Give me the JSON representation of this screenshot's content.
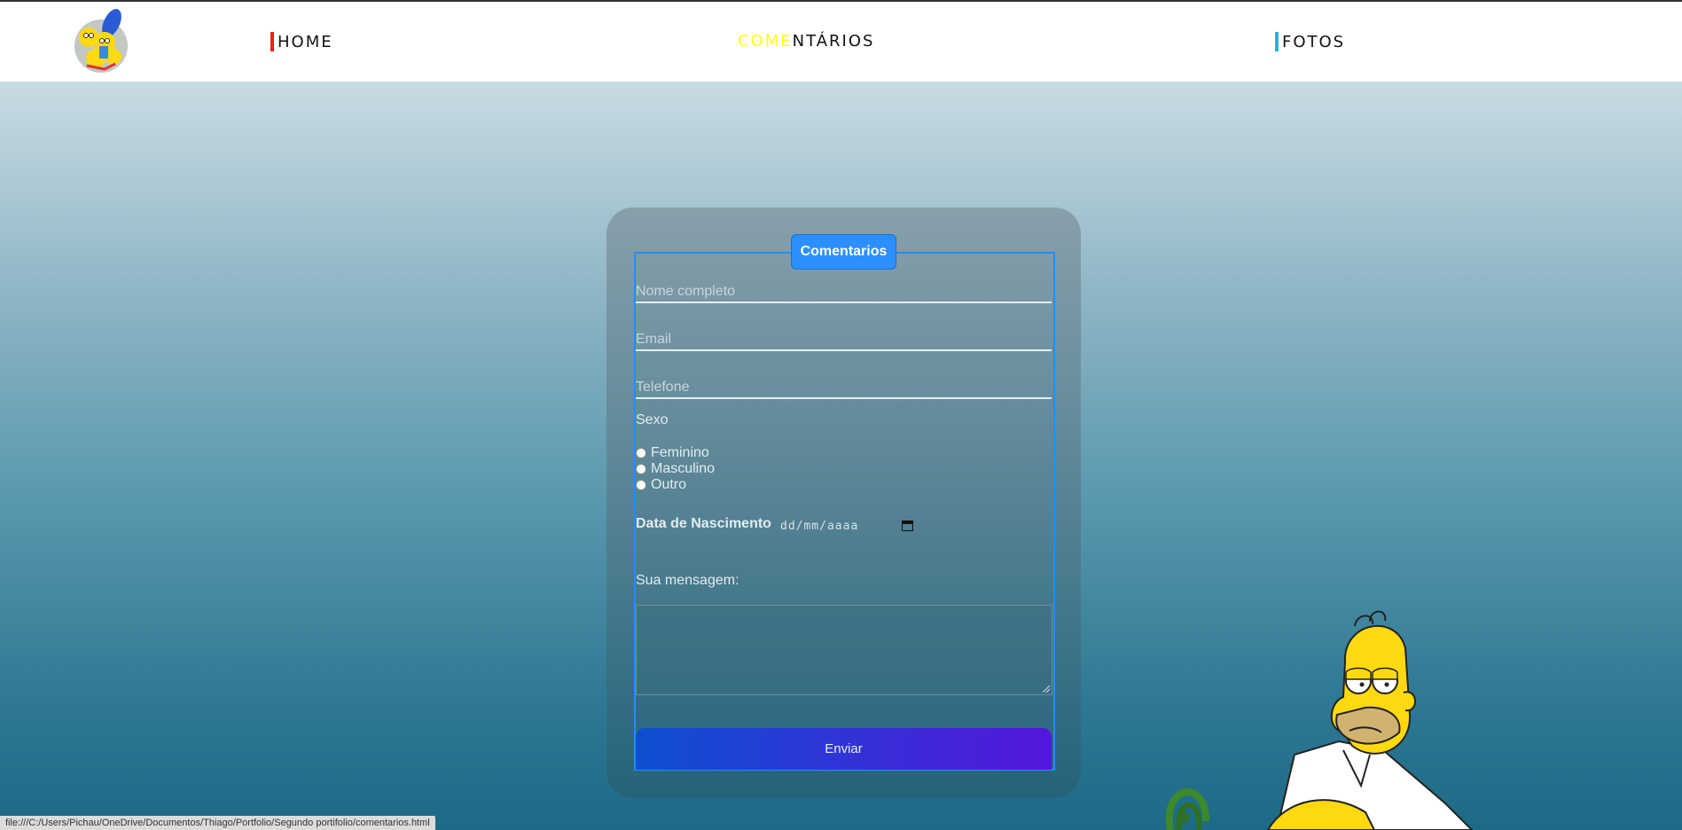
{
  "nav": {
    "home": "HOME",
    "comentarios": "COMENTÁRIOS",
    "fotos": "FOTOS",
    "home_marker_color": "#ff1a1a",
    "fotos_marker_color": "#1ab8d8",
    "highlight_color": "#ffff00"
  },
  "form": {
    "legend": "Comentarios",
    "name_placeholder": "Nome completo",
    "email_placeholder": "Email",
    "phone_placeholder": "Telefone",
    "sex_label": "Sexo",
    "sex_options": [
      "Feminino",
      "Masculino",
      "Outro"
    ],
    "birth_label": "Data de Nascimento",
    "date_placeholder": "dd/mm/aaaa",
    "message_label": "Sua mensagem:",
    "submit_label": "Enviar"
  },
  "status_url": "file:///C:/Users/Pichau/OneDrive/Documentos/Thiago/Portfolio/Segundo portifolio/comentarios.html",
  "colors": {
    "legend_bg": "#2b8fff",
    "submit_gradient_start": "#0d50d0",
    "submit_gradient_end": "#5416dc"
  },
  "icons": {
    "logo": "simpsons-family-logo",
    "calendar": "calendar-icon",
    "character": "homer-simpson-illustration"
  }
}
